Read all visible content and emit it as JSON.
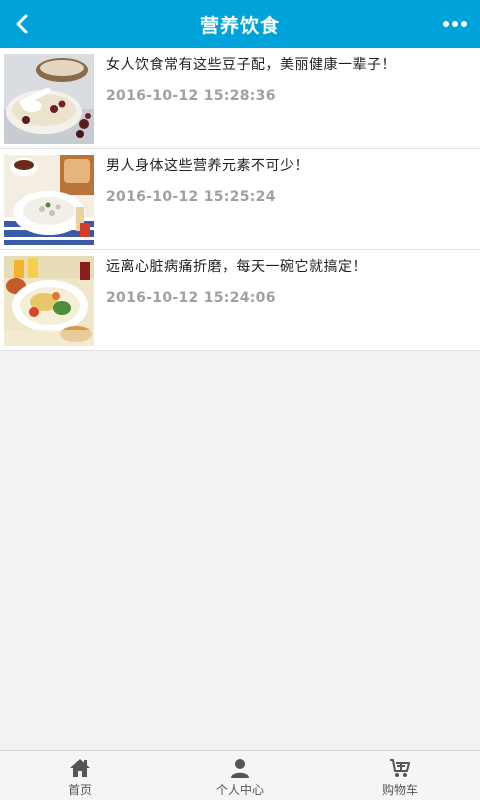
{
  "header": {
    "title": "营养饮食"
  },
  "articles": [
    {
      "title": "女人饮食常有这些豆子配，美丽健康一辈子！",
      "time": "2016-10-12 15:28:36"
    },
    {
      "title": "男人身体这些营养元素不可少！",
      "time": "2016-10-12 15:25:24"
    },
    {
      "title": "远离心脏病痛折磨，每天一碗它就搞定！",
      "time": "2016-10-12 15:24:06"
    }
  ],
  "bottom_nav": [
    {
      "label": "首页",
      "icon": "home-icon"
    },
    {
      "label": "个人中心",
      "icon": "user-icon"
    },
    {
      "label": "购物车",
      "icon": "cart-icon"
    }
  ],
  "colors": {
    "accent": "#00a3d9",
    "time_text": "#a0a0a0",
    "background": "#f2f2f2"
  }
}
